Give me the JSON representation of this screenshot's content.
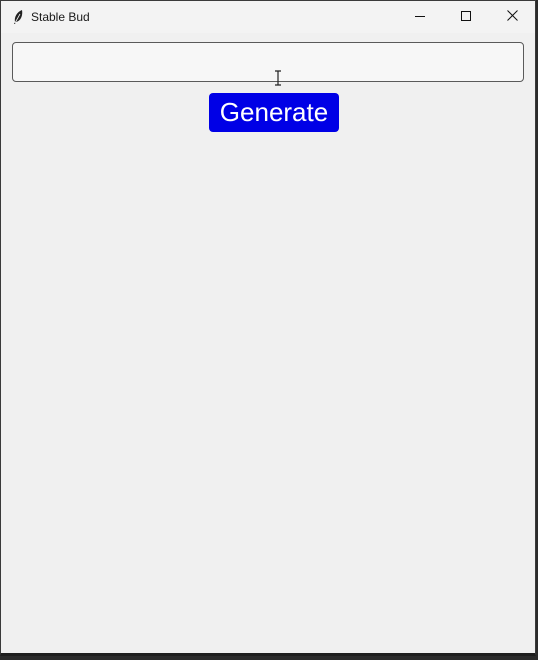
{
  "window": {
    "title": "Stable Bud",
    "app_icon": "feather-icon",
    "minimize_icon": "minimize-icon",
    "maximize_icon": "maximize-icon",
    "close_icon": "close-icon"
  },
  "prompt": {
    "value": "",
    "placeholder": ""
  },
  "generate_button": {
    "label": "Generate",
    "color": "#0000e6"
  },
  "colors": {
    "window_background": "#f0f0f0",
    "button_text": "#ffffff"
  }
}
